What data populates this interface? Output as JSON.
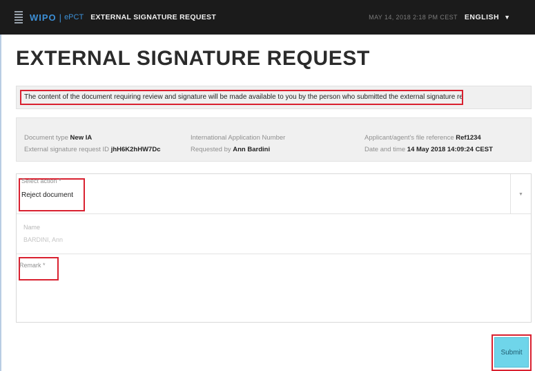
{
  "header": {
    "logo_wipo": "WIPO",
    "logo_separator": "|",
    "logo_epct": "ePCT",
    "title": "EXTERNAL SIGNATURE REQUEST",
    "datetime": "MAY 14, 2018 2:18 PM CEST",
    "language": "ENGLISH",
    "caret": "▼"
  },
  "page": {
    "title": "EXTERNAL SIGNATURE REQUEST",
    "notice": "The content of the document requiring review and signature will be made available to you by the person who submitted the external signature request"
  },
  "details": {
    "document_type_label": "Document type",
    "document_type_value": "New IA",
    "request_id_label": "External signature request ID",
    "request_id_value": "jhH6K2hHW7Dc",
    "ia_number_label": "International Application Number",
    "ia_number_value": "",
    "requested_by_label": "Requested by",
    "requested_by_value": "Ann Bardini",
    "file_ref_label": "Applicant/agent's file reference",
    "file_ref_value": "Ref1234",
    "datetime_label": "Date and time",
    "datetime_value": "14 May 2018 14:09:24 CEST"
  },
  "form": {
    "select_action_label": "Select action *",
    "select_action_value": "Reject document",
    "select_arrow": "▼",
    "name_label": "Name",
    "name_value": "BARDINI, Ann",
    "remark_label": "Remark *",
    "remark_value": ""
  },
  "actions": {
    "submit_label": "Submit"
  },
  "colors": {
    "header_bg": "#1b1b1b",
    "brand_blue": "#3c8fd6",
    "highlight_red": "#d9202f",
    "submit_bg": "#6fd5ea"
  },
  "icons": {
    "logo": "wipo-logo-icon",
    "language_caret": "caret-down-icon",
    "select_arrow": "chevron-down-icon"
  }
}
